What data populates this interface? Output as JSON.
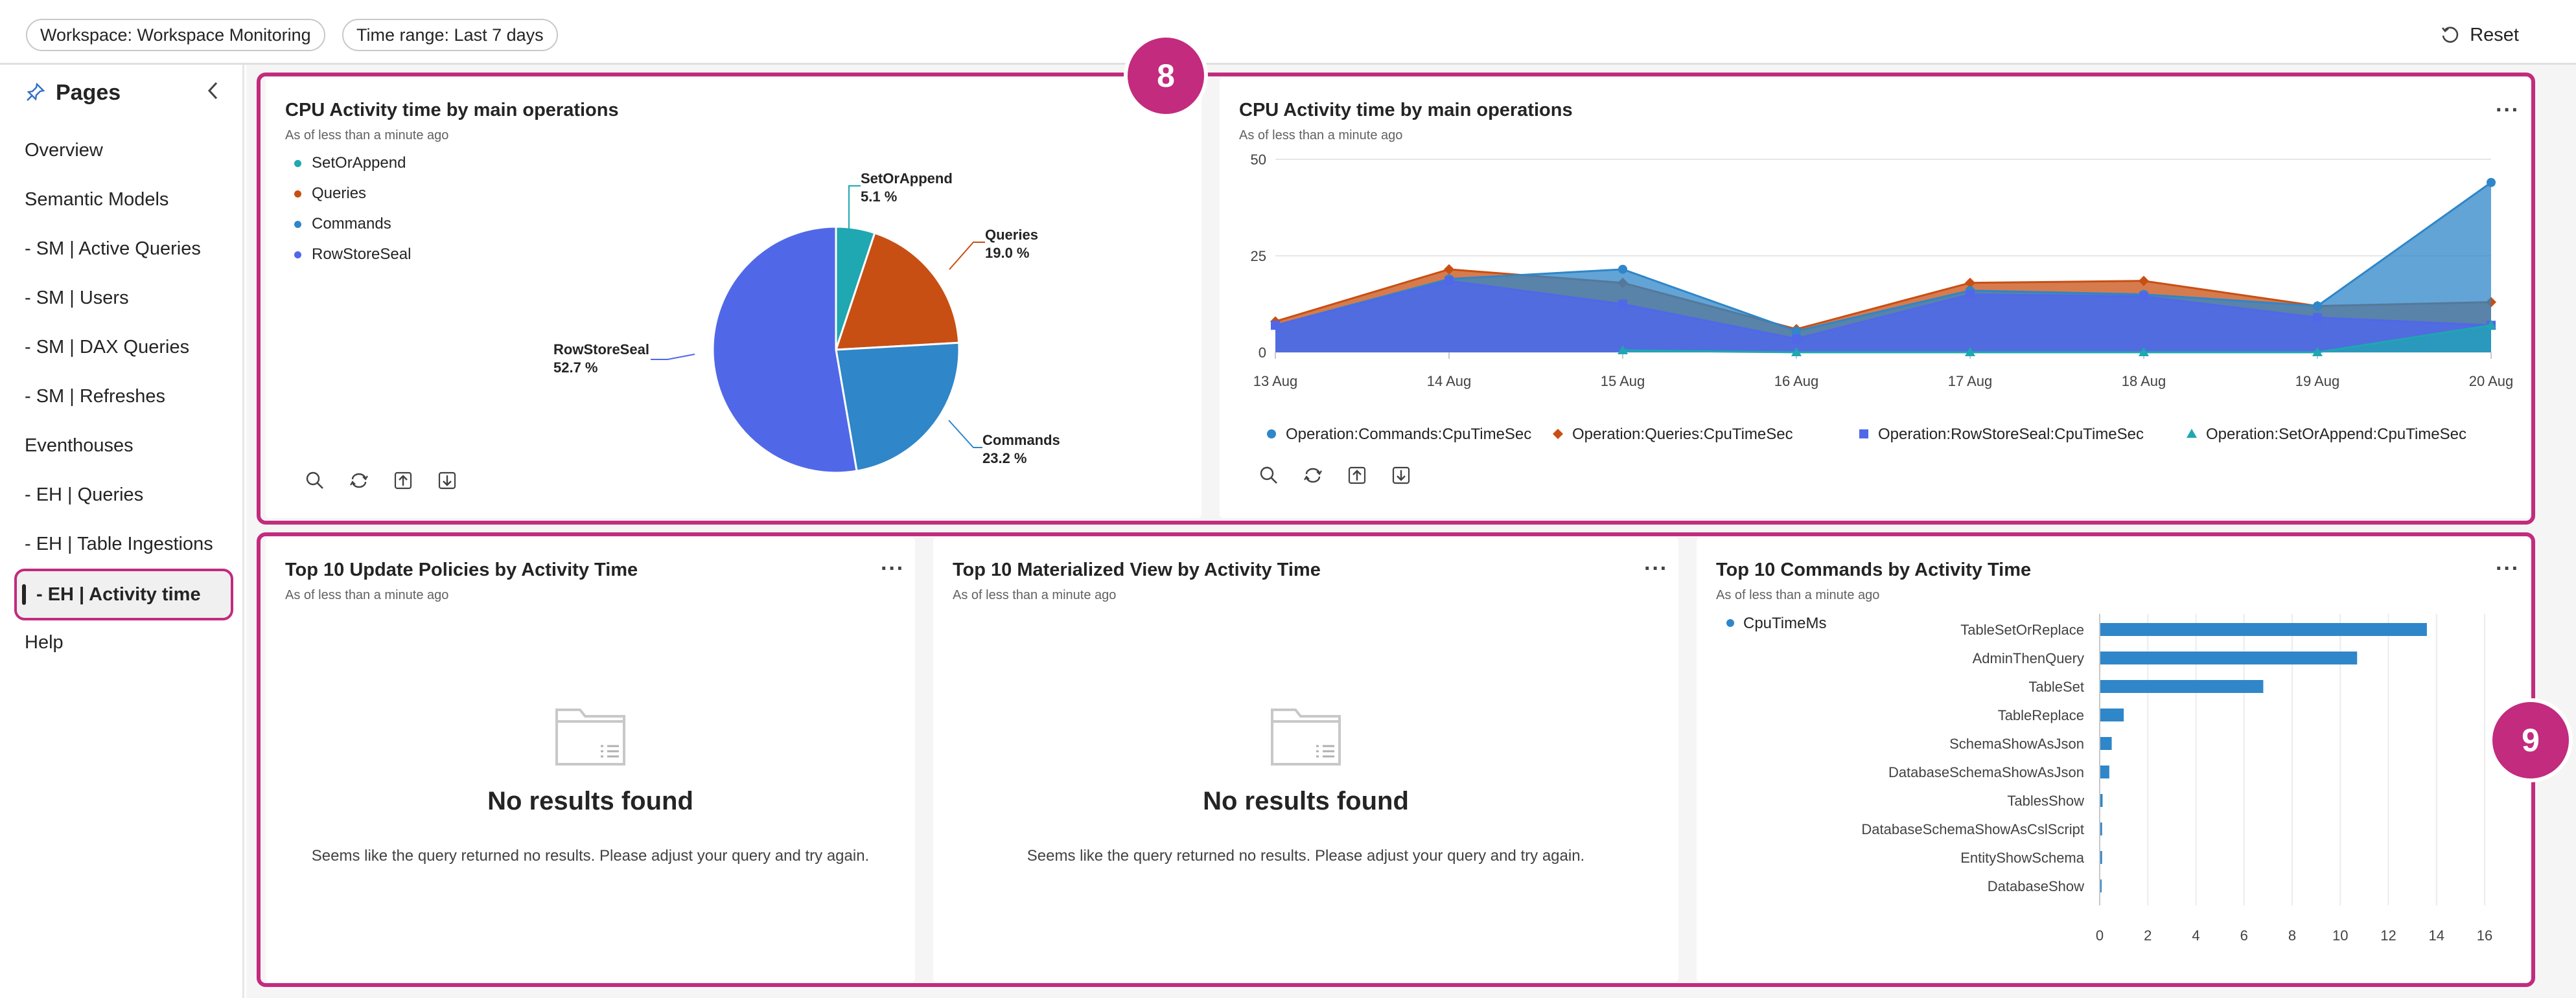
{
  "filters": {
    "workspace": "Workspace: Workspace Monitoring",
    "time_range": "Time range: Last 7 days",
    "reset_label": "Reset"
  },
  "sidebar": {
    "title": "Pages",
    "items": [
      {
        "label": "Overview"
      },
      {
        "label": "Semantic Models"
      },
      {
        "label": "- SM | Active Queries"
      },
      {
        "label": "- SM | Users"
      },
      {
        "label": "- SM | DAX Queries"
      },
      {
        "label": "- SM | Refreshes"
      },
      {
        "label": "Eventhouses"
      },
      {
        "label": "- EH | Queries"
      },
      {
        "label": "- EH | Table Ingestions"
      },
      {
        "label": "- EH | Activity time",
        "active": true
      },
      {
        "label": "Help"
      }
    ]
  },
  "callouts": {
    "top": "8",
    "bottom": "9"
  },
  "tiles": {
    "pie": {
      "title": "CPU Activity time by main operations",
      "subtitle": "As of less than a minute ago"
    },
    "line": {
      "title": "CPU Activity time by main operations",
      "subtitle": "As of less than a minute ago"
    },
    "update_policies": {
      "title": "Top 10 Update Policies by Activity Time",
      "subtitle": "As of less than a minute ago",
      "empty_title": "No results found",
      "empty_text": "Seems like the query returned no results. Please adjust your query and try again."
    },
    "materialized": {
      "title": "Top 10 Materialized View by Activity Time",
      "subtitle": "As of less than a minute ago",
      "empty_title": "No results found",
      "empty_text": "Seems like the query returned no results. Please adjust your query and try again."
    },
    "commands": {
      "title": "Top 10 Commands by Activity Time",
      "subtitle": "As of less than a minute ago"
    }
  },
  "colors": {
    "setorappend": "#1fa7b2",
    "queries": "#c84f13",
    "commands": "#2f86c8",
    "rowstoreseal": "#5068e8",
    "accent": "#c22b7e"
  },
  "chart_data": [
    {
      "type": "pie",
      "title": "CPU Activity time by main operations",
      "legend": [
        "SetOrAppend",
        "Queries",
        "Commands",
        "RowStoreSeal"
      ],
      "slices": [
        {
          "name": "SetOrAppend",
          "label": "5.1 %",
          "value": 5.1,
          "color": "#1fa7b2"
        },
        {
          "name": "Queries",
          "label": "19.0 %",
          "value": 19.0,
          "color": "#c84f13"
        },
        {
          "name": "Commands",
          "label": "23.2 %",
          "value": 23.2,
          "color": "#2f86c8"
        },
        {
          "name": "RowStoreSeal",
          "label": "52.7 %",
          "value": 52.7,
          "color": "#5068e8"
        }
      ]
    },
    {
      "type": "area",
      "title": "CPU Activity time by main operations",
      "categories": [
        "13 Aug",
        "14 Aug",
        "15 Aug",
        "16 Aug",
        "17 Aug",
        "18 Aug",
        "19 Aug",
        "20 Aug"
      ],
      "ylim": [
        0,
        50
      ],
      "yticks": [
        0,
        25,
        50
      ],
      "grid": true,
      "legend_position": "bottom",
      "series": [
        {
          "name": "Operation:Commands:CpuTimeSec",
          "color": "#2f86c8",
          "marker": "circle",
          "points": [
            {
              "x": 0,
              "y": 7
            },
            {
              "x": 1,
              "y": 19
            },
            {
              "x": 2,
              "y": 21.5
            },
            {
              "x": 3,
              "y": 5.5
            },
            {
              "x": 4,
              "y": 16
            },
            {
              "x": 5,
              "y": 15
            },
            {
              "x": 6,
              "y": 12
            },
            {
              "x": 7,
              "y": 44
            }
          ]
        },
        {
          "name": "Operation:Queries:CpuTimeSec",
          "color": "#c84f13",
          "marker": "diamond",
          "points": [
            {
              "x": 0,
              "y": 8
            },
            {
              "x": 1,
              "y": 21.5
            },
            {
              "x": 2,
              "y": 18
            },
            {
              "x": 3,
              "y": 6
            },
            {
              "x": 4,
              "y": 18
            },
            {
              "x": 5,
              "y": 18.5
            },
            {
              "x": 6,
              "y": 12
            },
            {
              "x": 7,
              "y": 13
            }
          ]
        },
        {
          "name": "Operation:RowStoreSeal:CpuTimeSec",
          "color": "#5068e8",
          "marker": "square",
          "points": [
            {
              "x": 0,
              "y": 7
            },
            {
              "x": 1,
              "y": 18.5
            },
            {
              "x": 2,
              "y": 12.5
            },
            {
              "x": 3,
              "y": 3.5
            },
            {
              "x": 4,
              "y": 15
            },
            {
              "x": 5,
              "y": 14.5
            },
            {
              "x": 6,
              "y": 9
            },
            {
              "x": 7,
              "y": 7
            }
          ]
        },
        {
          "name": "Operation:SetOrAppend:CpuTimeSec",
          "color": "#1fa7b2",
          "marker": "triangle",
          "points": [
            {
              "x": 2,
              "y": 0.5
            },
            {
              "x": 3,
              "y": 0
            },
            {
              "x": 4,
              "y": 0
            },
            {
              "x": 5,
              "y": 0
            },
            {
              "x": 6,
              "y": 0
            },
            {
              "x": 7,
              "y": 7
            }
          ]
        }
      ]
    },
    {
      "type": "bar",
      "orientation": "horizontal",
      "title": "Top 10 Commands by Activity Time",
      "legend": [
        "CpuTimeMs"
      ],
      "categories": [
        "TableSetOrReplace",
        "AdminThenQuery",
        "TableSet",
        "TableReplace",
        "SchemaShowAsJson",
        "DatabaseSchemaShowAsJson",
        "TablesShow",
        "DatabaseSchemaShowAsCslScript",
        "EntityShowSchema",
        "DatabaseShow"
      ],
      "values": [
        13.6,
        10.7,
        6.8,
        1.0,
        0.5,
        0.4,
        0.12,
        0.1,
        0.1,
        0.03
      ],
      "xlim": [
        0,
        16
      ],
      "xticks": [
        0,
        2,
        4,
        6,
        8,
        10,
        12,
        14,
        16
      ],
      "color": "#2f86c8",
      "grid": true
    }
  ]
}
